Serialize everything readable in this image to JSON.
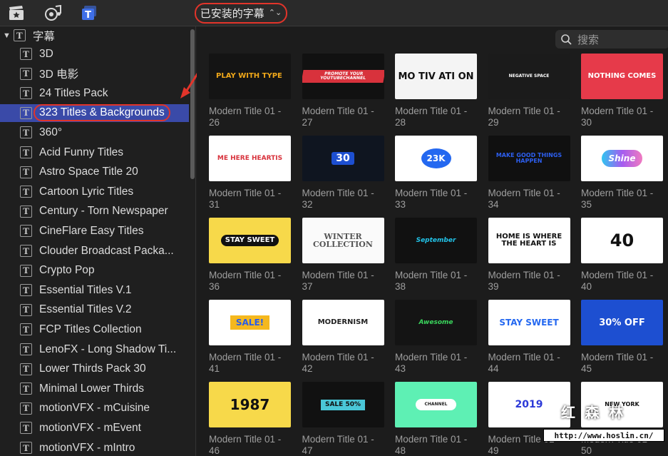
{
  "toolbar": {
    "icons": [
      "clapper-star-icon",
      "photos-music-icon",
      "titles-generators-icon"
    ],
    "dropdown_label": "已安装的字幕"
  },
  "sidebar": {
    "root_label": "字幕",
    "items": [
      "3D",
      "3D 电影",
      "24 Titles Pack",
      "323 Titles & Backgrounds",
      "360°",
      "Acid Funny Titles",
      "Astro Space Title 20",
      "Cartoon Lyric Titles",
      "Century - Torn Newspaper",
      "CineFlare Easy Titles",
      "Clouder Broadcast Packa...",
      "Crypto Pop",
      "Essential Titles V.1",
      "Essential Titles V.2",
      "FCP Titles Collection",
      "LenoFX - Long Shadow Ti...",
      "Lower Thirds Pack 30",
      "Minimal Lower Thirds",
      "motionVFX - mCuisine",
      "motionVFX - mEvent",
      "motionVFX - mIntro"
    ],
    "selected_index": 3
  },
  "search": {
    "placeholder": "搜索"
  },
  "tiles": [
    {
      "caption": "Modern Title 01 -\n26",
      "art": "PLAY WITH TYPE"
    },
    {
      "caption": "Modern Title 01 -\n27",
      "art": "PROMOTE YOUR YOUTUBECHANNEL"
    },
    {
      "caption": "Modern Title 01 -\n28",
      "art": "MO TIV ATI ON"
    },
    {
      "caption": "Modern Title 01 -\n29",
      "art": "NEGATIVE SPACE"
    },
    {
      "caption": "Modern Title 01 -\n30",
      "art": "NOTHING COMES"
    },
    {
      "caption": "Modern Title 01 -\n31",
      "art": "ME HERE HEARTIS"
    },
    {
      "caption": "Modern Title 01 -\n32",
      "art": "30"
    },
    {
      "caption": "Modern Title 01 -\n33",
      "art": "23K"
    },
    {
      "caption": "Modern Title 01 -\n34",
      "art": "MAKE GOOD THINGS HAPPEN"
    },
    {
      "caption": "Modern Title 01 -\n35",
      "art": "Shine"
    },
    {
      "caption": "Modern Title 01 -\n36",
      "art": "STAY SWEET"
    },
    {
      "caption": "Modern Title 01 -\n37",
      "art": "WINTER COLLECTION"
    },
    {
      "caption": "Modern Title 01 -\n38",
      "art": "September"
    },
    {
      "caption": "Modern Title 01 -\n39",
      "art": "HOME IS WHERE THE HEART IS"
    },
    {
      "caption": "Modern Title 01 -\n40",
      "art": "40"
    },
    {
      "caption": "Modern Title 01 -\n41",
      "art": "SALE!"
    },
    {
      "caption": "Modern Title 01 -\n42",
      "art": "MODERNISM"
    },
    {
      "caption": "Modern Title 01 -\n43",
      "art": "Awesome"
    },
    {
      "caption": "Modern Title 01 -\n44",
      "art": "STAY SWEET"
    },
    {
      "caption": "Modern Title 01 -\n45",
      "art": "30% OFF"
    },
    {
      "caption": "Modern Title 01 -\n46",
      "art": "1987"
    },
    {
      "caption": "Modern Title 01 -\n47",
      "art": "SALE 50%"
    },
    {
      "caption": "Modern Title 01 -\n48",
      "art": "CHANNEL"
    },
    {
      "caption": "Modern Title 01 -\n49",
      "art": "2019"
    },
    {
      "caption": "Modern Title 01 -\n50",
      "art": "NEW YORK"
    }
  ],
  "watermark": {
    "logo": "红 森 林",
    "url": "http://www.hoslin.cn/"
  },
  "colors": {
    "accent_highlight": "#e2342a",
    "selection": "#3a4aa8"
  }
}
